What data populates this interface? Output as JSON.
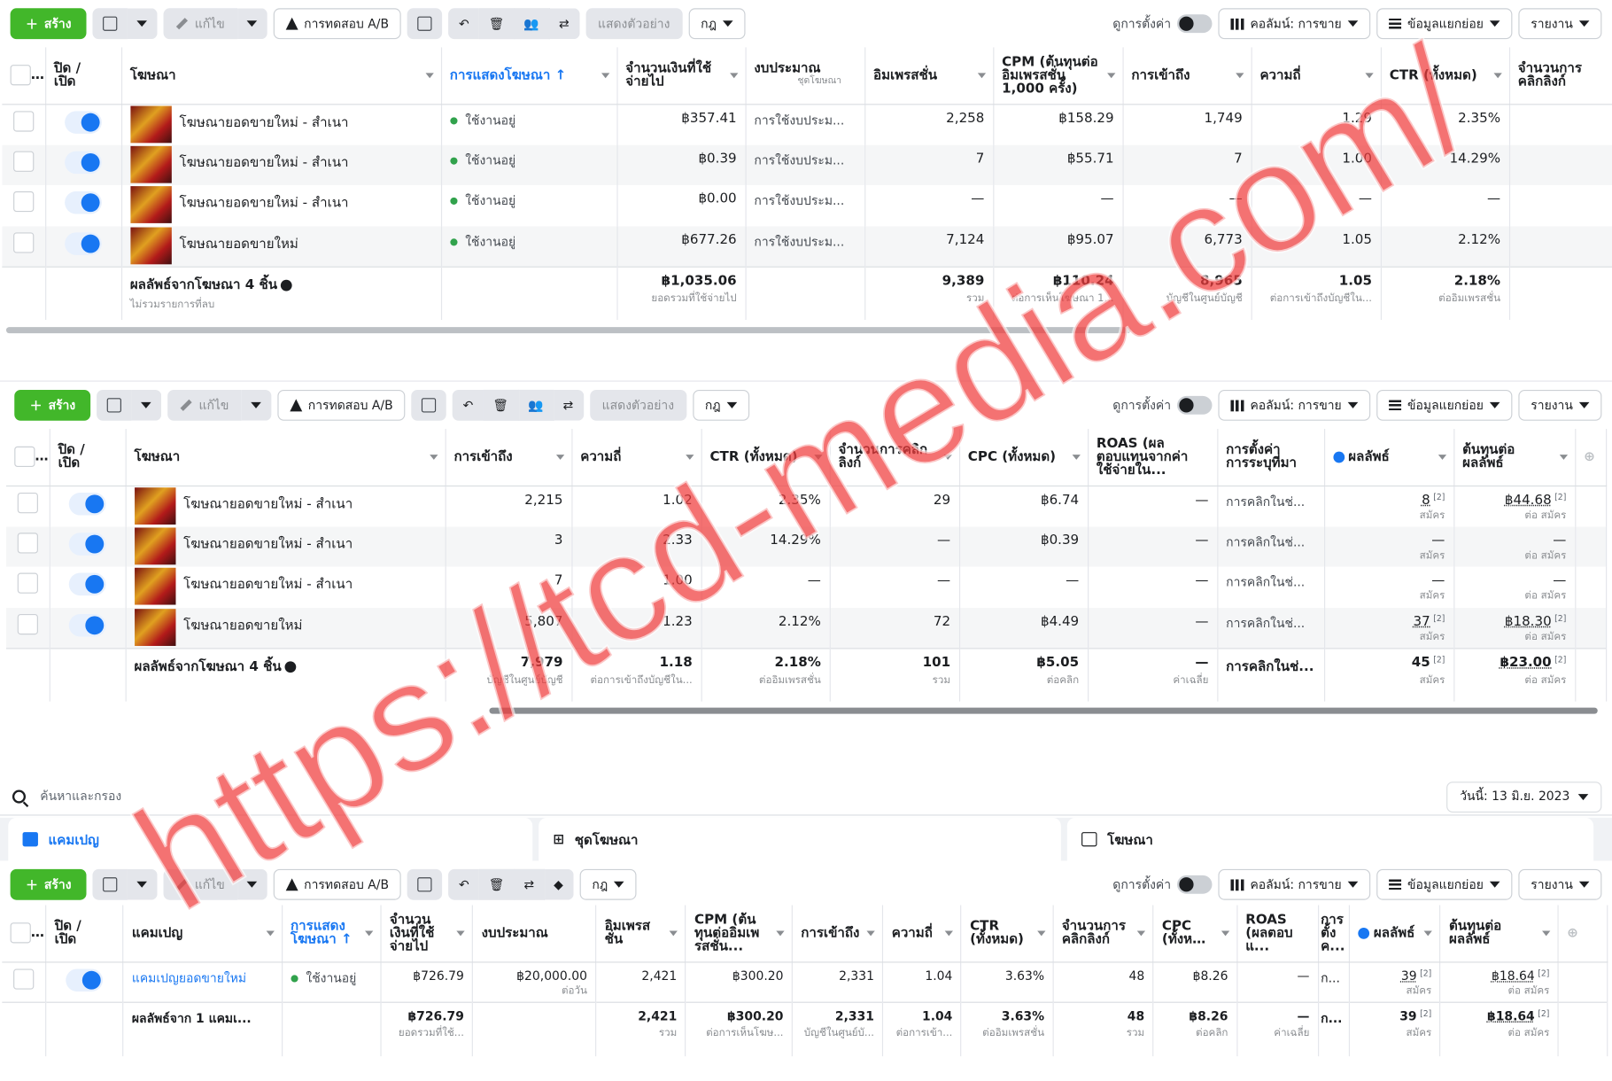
{
  "toolbar1": {
    "create": "สร้าง",
    "edit": "แก้ไข",
    "ab_test": "การทดสอบ A/B",
    "preview": "แสดงตัวอย่าง",
    "rules": "กฎ",
    "view_setup": "ดูการตั้งค่า",
    "columns": "คอลัมน์: การขาย",
    "breakdown": "ข้อมูลแยกย่อย",
    "reports": "รายงาน"
  },
  "toolbar2": {
    "create": "สร้าง",
    "edit": "แก้ไข",
    "ab_test": "การทดสอบ A/B",
    "preview": "แสดงตัวอย่าง",
    "rules": "กฎ",
    "view_setup": "ดูการตั้งค่า",
    "columns": "คอลัมน์: การขาย",
    "breakdown": "ข้อมูลแยกย่อย",
    "reports": "รายงาน"
  },
  "toolbar3": {
    "create": "สร้าง",
    "edit": "แก้ไข",
    "ab_test": "การทดสอบ A/B",
    "rules": "กฎ",
    "view_setup": "ดูการตั้งค่า",
    "columns": "คอลัมน์: การขาย",
    "breakdown": "ข้อมูลแยกย่อย",
    "reports": "รายงาน"
  },
  "table1": {
    "headers": {
      "toggle": "ปิด / เปิด",
      "ad": "โฆษณา",
      "delivery": "การแสดงโฆษณา ↑",
      "spent": "จำนวนเงินที่ใช้จ่ายไป",
      "budget": "งบประมาณ",
      "budget_sub": "ชุดโฆษณา",
      "impressions": "อิมเพรสชั่น",
      "cpm": "CPM (ต้นทุนต่ออิมเพรสชั่น 1,000 ครั้ง)",
      "reach": "การเข้าถึง",
      "frequency": "ความถี่",
      "ctr": "CTR (ทั้งหมด)",
      "clicks": "จำนวนการคลิกลิงก์"
    },
    "rows": [
      {
        "name": "โฆษณายอดขายใหม่ - สำเนา",
        "status": "ใช้งานอยู่",
        "spent": "฿357.41",
        "budget": "การใช้งบประม...",
        "impressions": "2,258",
        "cpm": "฿158.29",
        "reach": "1,749",
        "frequency": "1.29",
        "ctr": "2.35%"
      },
      {
        "name": "โฆษณายอดขายใหม่ - สำเนา",
        "status": "ใช้งานอยู่",
        "spent": "฿0.39",
        "budget": "การใช้งบประม...",
        "impressions": "7",
        "cpm": "฿55.71",
        "reach": "7",
        "frequency": "1.00",
        "ctr": "14.29%"
      },
      {
        "name": "โฆษณายอดขายใหม่ - สำเนา",
        "status": "ใช้งานอยู่",
        "spent": "฿0.00",
        "budget": "การใช้งบประม...",
        "impressions": "—",
        "cpm": "—",
        "reach": "—",
        "frequency": "—",
        "ctr": "—"
      },
      {
        "name": "โฆษณายอดขายใหม่",
        "status": "ใช้งานอยู่",
        "spent": "฿677.26",
        "budget": "การใช้งบประม...",
        "impressions": "7,124",
        "cpm": "฿95.07",
        "reach": "6,773",
        "frequency": "1.05",
        "ctr": "2.12%"
      }
    ],
    "total": {
      "title": "ผลลัพธ์จากโฆษณา 4 ชิ้น",
      "note": "ไม่รวมรายการที่ลบ",
      "spent": "฿1,035.06",
      "spent_sub": "ยอดรวมที่ใช้จ่ายไป",
      "impressions": "9,389",
      "impressions_sub": "รวม",
      "cpm": "฿110.24",
      "cpm_sub": "ต่อการเห็นโฆษณา 1...",
      "reach": "8,965",
      "reach_sub": "บัญชีในศูนย์บัญชี",
      "frequency": "1.05",
      "frequency_sub": "ต่อการเข้าถึงบัญชีใน...",
      "ctr": "2.18%",
      "ctr_sub": "ต่ออิมเพรสชั่น"
    }
  },
  "table2": {
    "headers": {
      "toggle": "ปิด / เปิด",
      "ad": "โฆษณา",
      "reach": "การเข้าถึง",
      "frequency": "ความถี่",
      "ctr": "CTR (ทั้งหมด)",
      "clicks": "จำนวนการคลิกลิงก์",
      "cpc": "CPC (ทั้งหมด)",
      "roas": "ROAS (ผลตอบแทนจากค่าใช้จ่ายใน...",
      "attribution": "การตั้งค่าการระบุที่มา",
      "results": "ผลลัพธ์",
      "cost": "ต้นทุนต่อผลลัพธ์"
    },
    "rows": [
      {
        "name": "โฆษณายอดขายใหม่ - สำเนา",
        "reach": "2,215",
        "frequency": "1.02",
        "ctr": "2.35%",
        "clicks": "29",
        "cpc": "฿6.74",
        "roas": "—",
        "attribution": "การคลิกในช่...",
        "results": "8",
        "results_sub": "สมัคร",
        "cost": "฿44.68",
        "cost_sub": "ต่อ สมัคร"
      },
      {
        "name": "โฆษณายอดขายใหม่ - สำเนา",
        "reach": "3",
        "frequency": "2.33",
        "ctr": "14.29%",
        "clicks": "—",
        "cpc": "฿0.39",
        "roas": "—",
        "attribution": "การคลิกในช่...",
        "results": "—",
        "results_sub": "สมัคร",
        "cost": "—",
        "cost_sub": "ต่อ สมัคร"
      },
      {
        "name": "โฆษณายอดขายใหม่ - สำเนา",
        "reach": "7",
        "frequency": "1.00",
        "ctr": "—",
        "clicks": "—",
        "cpc": "—",
        "roas": "—",
        "attribution": "การคลิกในช่...",
        "results": "—",
        "results_sub": "สมัคร",
        "cost": "—",
        "cost_sub": "ต่อ สมัคร"
      },
      {
        "name": "โฆษณายอดขายใหม่",
        "reach": "5,807",
        "frequency": "1.23",
        "ctr": "2.12%",
        "clicks": "72",
        "cpc": "฿4.49",
        "roas": "—",
        "attribution": "การคลิกในช่...",
        "results": "37",
        "results_sub": "สมัคร",
        "cost": "฿18.30",
        "cost_sub": "ต่อ สมัคร"
      }
    ],
    "total": {
      "title": "ผลลัพธ์จากโฆษณา 4 ชิ้น",
      "reach": "7,979",
      "reach_sub": "บัญชีในศูนย์บัญชี",
      "frequency": "1.18",
      "frequency_sub": "ต่อการเข้าถึงบัญชีใน...",
      "ctr": "2.18%",
      "ctr_sub": "ต่ออิมเพรสชั่น",
      "clicks": "101",
      "clicks_sub": "รวม",
      "cpc": "฿5.05",
      "cpc_sub": "ต่อคลิก",
      "roas": "—",
      "roas_sub": "ค่าเฉลี่ย",
      "attribution": "การคลิกในช่...",
      "results": "45",
      "results_sub": "สมัคร",
      "cost": "฿23.00",
      "cost_sub": "ต่อ สมัคร"
    }
  },
  "search": {
    "placeholder": "ค้นหาและกรอง",
    "date": "วันนี้: 13 มิ.ย. 2023"
  },
  "tabs": {
    "campaigns": "แคมเปญ",
    "adsets": "ชุดโฆษณา",
    "ads": "โฆษณา"
  },
  "table3": {
    "headers": {
      "toggle": "ปิด / เปิด",
      "campaign": "แคมเปญ",
      "delivery": "การแสดงโฆษณา ↑",
      "spent": "จำนวนเงินที่ใช้จ่ายไป",
      "budget": "งบประมาณ",
      "impressions": "อิมเพรสชั่น",
      "cpm": "CPM (ต้นทุนต่ออิมเพรสชั่น...",
      "reach": "การเข้าถึง",
      "frequency": "ความถี่",
      "ctr": "CTR (ทั้งหมด)",
      "clicks": "จำนวนการคลิกลิงก์",
      "cpc": "CPC (ทั้งหมด)",
      "roas": "ROAS (ผลตอบแ...",
      "attribution": "การตั้งค...",
      "results": "ผลลัพธ์",
      "cost": "ต้นทุนต่อผลลัพธ์"
    },
    "row": {
      "name": "แคมเปญยอดขายใหม่",
      "status": "ใช้งานอยู่",
      "spent": "฿726.79",
      "budget": "฿20,000.00",
      "budget_sub": "ต่อวัน",
      "impressions": "2,421",
      "cpm": "฿300.20",
      "reach": "2,331",
      "frequency": "1.04",
      "ctr": "3.63%",
      "clicks": "48",
      "cpc": "฿8.26",
      "roas": "—",
      "attribution": "ก...",
      "results": "39",
      "results_sub": "สมัคร",
      "cost": "฿18.64",
      "cost_sub": "ต่อ สมัคร"
    },
    "total": {
      "title": "ผลลัพธ์จาก 1 แคมเ...",
      "spent": "฿726.79",
      "spent_sub": "ยอดรวมที่ใช้...",
      "impressions": "2,421",
      "impressions_sub": "รวม",
      "cpm": "฿300.20",
      "cpm_sub": "ต่อการเห็นโฆษ...",
      "reach": "2,331",
      "reach_sub": "บัญชีในศูนย์บั...",
      "frequency": "1.04",
      "frequency_sub": "ต่อการเข้า...",
      "ctr": "3.63%",
      "ctr_sub": "ต่ออิมเพรสชั่น",
      "clicks": "48",
      "clicks_sub": "รวม",
      "cpc": "฿8.26",
      "cpc_sub": "ต่อคลิก",
      "roas": "—",
      "roas_sub": "ค่าเฉลี่ย",
      "attribution": "ก...",
      "results": "39",
      "results_sub": "สมัคร",
      "cost": "฿18.64",
      "cost_sub": "ต่อ สมัคร"
    }
  },
  "footnote_mark": "[2]",
  "watermark": "https://tcd-media.com/",
  "colors": {
    "accent": "#1877f2",
    "create": "#42b72a",
    "active": "#31a24c",
    "watermark": "#f03c3c"
  }
}
